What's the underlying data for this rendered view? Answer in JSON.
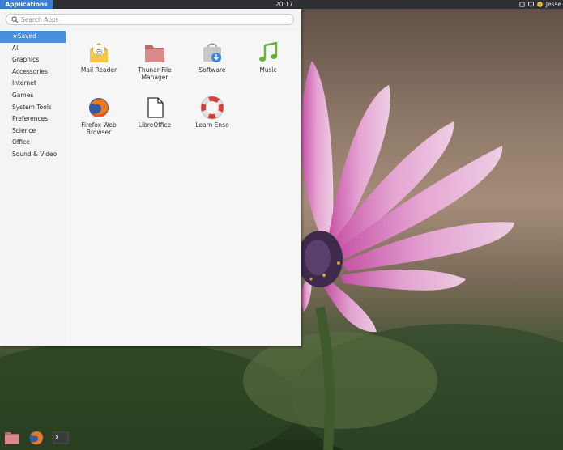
{
  "panel": {
    "apps_button": "Applications",
    "clock": "20:17",
    "user": "Jesse"
  },
  "search": {
    "placeholder": "Search Apps",
    "value": ""
  },
  "categories": [
    {
      "label": "★Saved",
      "selected": true
    },
    {
      "label": "All"
    },
    {
      "label": "Graphics"
    },
    {
      "label": "Accessories"
    },
    {
      "label": "Internet"
    },
    {
      "label": "Games"
    },
    {
      "label": "System Tools"
    },
    {
      "label": "Preferences"
    },
    {
      "label": "Science"
    },
    {
      "label": "Office"
    },
    {
      "label": "Sound & Video"
    }
  ],
  "apps": [
    {
      "label": "Mail Reader",
      "icon": "mail-reader-icon"
    },
    {
      "label": "Thunar File Manager",
      "icon": "folder-icon"
    },
    {
      "label": "Software",
      "icon": "software-store-icon"
    },
    {
      "label": "Music",
      "icon": "music-note-icon"
    },
    {
      "label": "Firefox Web Browser",
      "icon": "firefox-icon"
    },
    {
      "label": "LibreOffice",
      "icon": "document-icon"
    },
    {
      "label": "Learn Enso",
      "icon": "lifebuoy-icon"
    }
  ],
  "dock": [
    {
      "icon": "folder-icon"
    },
    {
      "icon": "firefox-icon"
    },
    {
      "icon": "terminal-icon"
    }
  ],
  "colors": {
    "accent": "#4a8fdc",
    "panel_bg": "#2f3033",
    "menu_bg": "#f4f4f4"
  }
}
